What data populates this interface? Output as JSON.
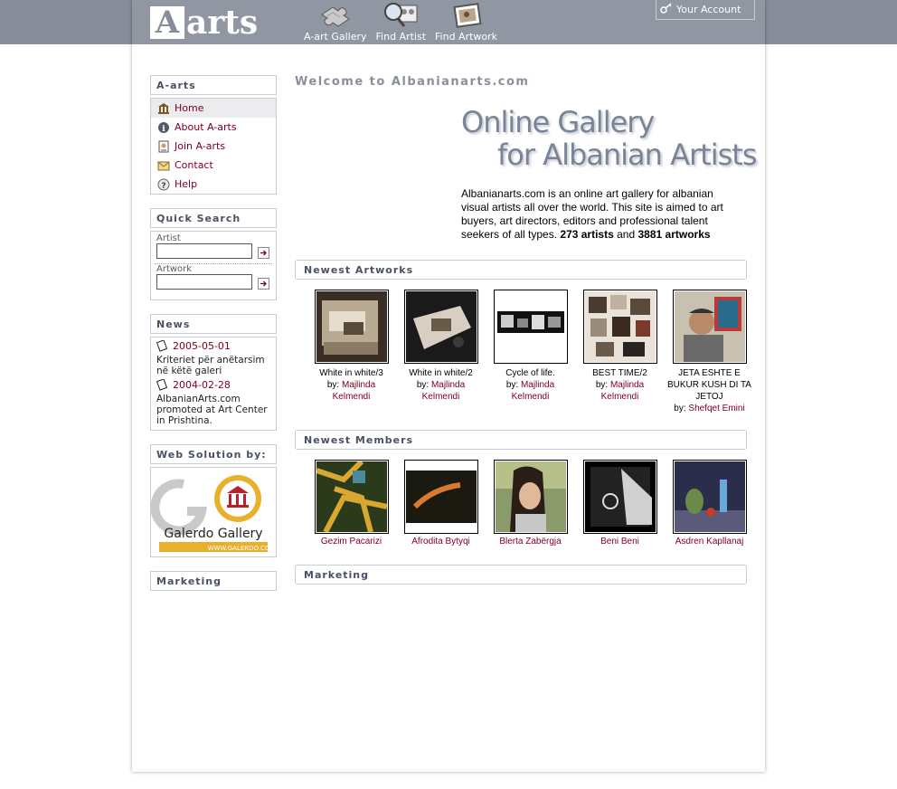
{
  "header": {
    "logo_letter": "A",
    "logo_text": "arts",
    "nav": [
      {
        "label": "A-art Gallery",
        "icon": "puzzle-icon"
      },
      {
        "label": "Find Artist",
        "icon": "magnifier-icon"
      },
      {
        "label": "Find Artwork",
        "icon": "picture-frame-icon"
      }
    ],
    "account_label": "Your Account"
  },
  "sidebar": {
    "menu_title": "A-arts",
    "menu": [
      {
        "label": "Home",
        "icon": "museum-icon"
      },
      {
        "label": "About A-arts",
        "icon": "info-icon"
      },
      {
        "label": "Join A-arts",
        "icon": "register-icon"
      },
      {
        "label": "Contact",
        "icon": "envelope-icon"
      },
      {
        "label": "Help",
        "icon": "help-icon"
      }
    ],
    "quick_search": {
      "title": "Quick Search",
      "artist_label": "Artist",
      "artwork_label": "Artwork"
    },
    "news": {
      "title": "News",
      "items": [
        {
          "date": "2005-05-01",
          "text": "Kriteriet për anëtarsim në këtë galeri"
        },
        {
          "date": "2004-02-28",
          "text": "AlbanianArts.com promoted at Art Center in Prishtina."
        }
      ]
    },
    "web_solution": {
      "title": "Web Solution by:",
      "logo_name": "Galerdo Gallery",
      "logo_url": "WWW.GALERDO.COM"
    },
    "marketing_title": "Marketing"
  },
  "main": {
    "welcome": "Welcome to Albanianarts.com",
    "hero_line1": "Online Gallery",
    "hero_line2": "for Albanian Artists",
    "intro_text": "Albanianarts.com is an online art gallery for albanian visual artists all over the world. This site is aimed to art buyers, art directors, editors and professional talent seekers of all types.",
    "artists_count": "273 artists",
    "and_word": "and",
    "artworks_count": "3881 artworks",
    "newest_artworks_title": "Newest Artworks",
    "by_label": "by:",
    "artworks": [
      {
        "title": "White in white/3",
        "artist": "Majlinda Kelmendi"
      },
      {
        "title": "White in white/2",
        "artist": "Majlinda Kelmendi"
      },
      {
        "title": "Cycle of life.",
        "artist": "Majlinda Kelmendi"
      },
      {
        "title": "BEST TIME/2",
        "artist": "Majlinda Kelmendi"
      },
      {
        "title": "JETA ESHTE E BUKUR KUSH DI TA JETOJ",
        "artist": "Shefqet Emini"
      }
    ],
    "newest_members_title": "Newest Members",
    "members": [
      {
        "name": "Gezim Pacarizi"
      },
      {
        "name": "Afrodita Bytyqi"
      },
      {
        "name": "Blerta Zabërgja"
      },
      {
        "name": "Beni Beni"
      },
      {
        "name": "Asdren Kapllanaj"
      }
    ],
    "marketing_title": "Marketing"
  },
  "colors": {
    "topbar": "#878d99",
    "link": "#800020",
    "heading": "#4a5066"
  }
}
